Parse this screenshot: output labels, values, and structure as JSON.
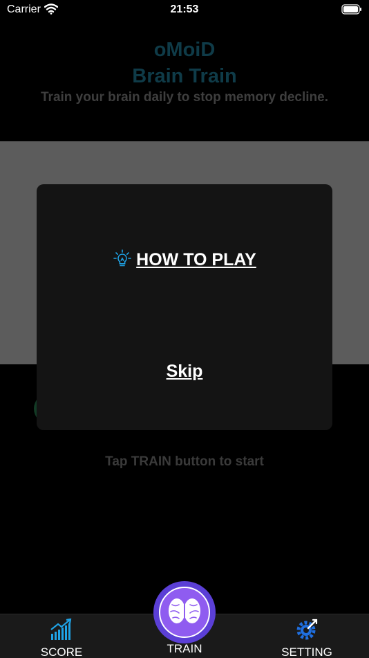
{
  "status_bar": {
    "carrier": "Carrier",
    "time": "21:53"
  },
  "header": {
    "app_name": "oMoiD",
    "app_subtitle": "Brain Train",
    "tagline": "Train your brain daily to stop memory decline."
  },
  "main": {
    "hint": "Tap TRAIN button to start"
  },
  "modal": {
    "how_to_play": "HOW TO PLAY",
    "skip": "Skip"
  },
  "tabbar": {
    "score": "SCORE",
    "train": "TRAIN",
    "setting": "SETTING"
  },
  "icons": {
    "wifi": "wifi-icon",
    "battery": "battery-icon",
    "lightbulb": "lightbulb-icon",
    "score": "chart-icon",
    "train": "brain-icon",
    "setting": "gear-icon"
  },
  "colors": {
    "background": "#000000",
    "title": "#0f3b48",
    "modal": "#141414",
    "accent_blue": "#1fa3e6",
    "train_button": "#8f5cf0"
  }
}
